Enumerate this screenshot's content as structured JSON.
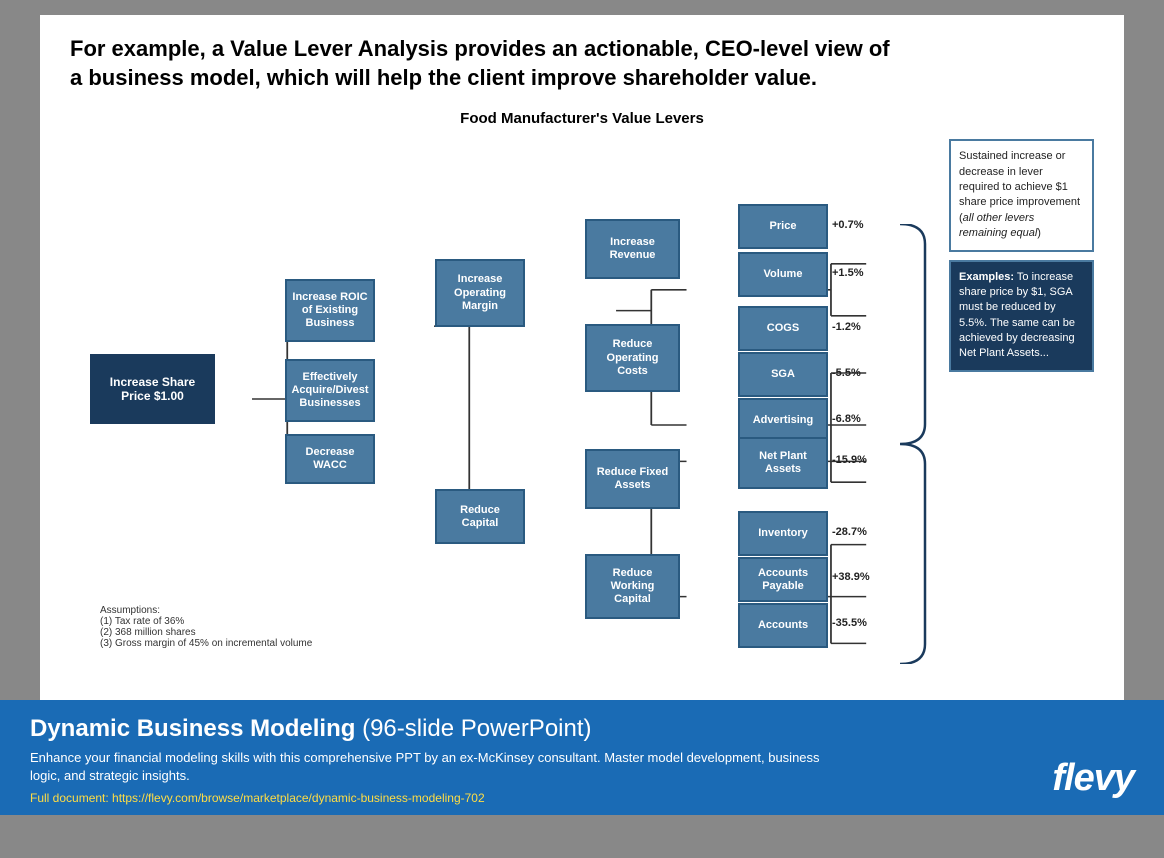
{
  "title": "For example, a Value Lever Analysis provides an actionable, CEO-level view of a business model, which will help the client improve shareholder value.",
  "chart_title": "Food Manufacturer's Value Levers",
  "boxes": {
    "increase_share_price": "Increase Share Price $1.00",
    "increase_roic": "Increase ROIC of Existing Business",
    "effectively_acquire": "Effectively Acquire/Divest Businesses",
    "decrease_wacc": "Decrease WACC",
    "increase_operating_margin": "Increase Operating Margin",
    "reduce_capital": "Reduce Capital",
    "increase_revenue": "Increase Revenue",
    "reduce_operating_costs": "Reduce Operating Costs",
    "reduce_fixed_assets": "Reduce Fixed Assets",
    "reduce_working_capital": "Reduce Working Capital",
    "price": "Price",
    "volume": "Volume",
    "cogs": "COGS",
    "sga": "SGA",
    "advertising": "Advertising",
    "net_plant_assets": "Net Plant Assets",
    "inventory": "Inventory",
    "accounts_payable": "Accounts Payable",
    "accounts": "Accounts"
  },
  "values": {
    "price": "+0.7%",
    "volume": "+1.5%",
    "cogs": "-1.2%",
    "sga": "-5.5%",
    "advertising": "-6.8%",
    "net_plant_assets": "-15.9%",
    "inventory": "-28.7%",
    "accounts_payable": "+38.9%",
    "accounts": "-35.5%"
  },
  "panel_light": {
    "text": "Sustained increase or decrease in lever required to achieve $1 share price improvement (",
    "italic": "all other levers remaining equal",
    "text2": ")"
  },
  "panel_dark": {
    "header": "Examples:",
    "body": "To increase share price by $1, SGA must be reduced by 5.5%. The same can be achieved by decreasing Net Plant Assets..."
  },
  "assumptions": {
    "header": "Assumptions:",
    "items": [
      "(1)  Tax rate of 36%",
      "(2)  368 million shares",
      "(3)  Gross margin of 45% on incremental volume"
    ]
  },
  "footer": {
    "title_bold": "Dynamic Business Modeling",
    "title_normal": " (96-slide PowerPoint)",
    "description": "Enhance your financial modeling skills with this comprehensive PPT by an ex-McKinsey consultant. Master model development, business logic, and strategic insights.",
    "link": "Full document: https://flevy.com/browse/marketplace/dynamic-business-modeling-702",
    "logo": "flevy"
  }
}
